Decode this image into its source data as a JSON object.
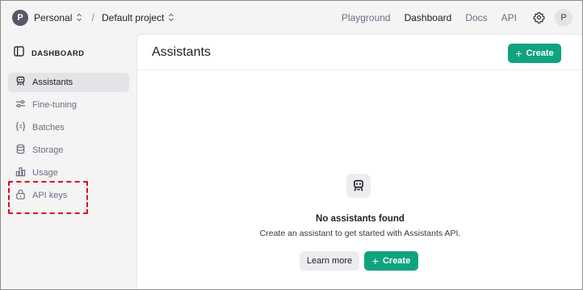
{
  "topbar": {
    "org_avatar": "P",
    "org_name": "Personal",
    "separator": "/",
    "project_name": "Default project",
    "nav": [
      {
        "label": "Playground",
        "active": false
      },
      {
        "label": "Dashboard",
        "active": true
      },
      {
        "label": "Docs",
        "active": false
      },
      {
        "label": "API",
        "active": false
      }
    ],
    "user_avatar": "P"
  },
  "sidebar": {
    "header": "DASHBOARD",
    "items": [
      {
        "label": "Assistants",
        "icon": "robot-icon",
        "active": true
      },
      {
        "label": "Fine-tuning",
        "icon": "sliders-icon",
        "active": false
      },
      {
        "label": "Batches",
        "icon": "braces-icon",
        "active": false
      },
      {
        "label": "Storage",
        "icon": "database-icon",
        "active": false
      },
      {
        "label": "Usage",
        "icon": "bar-chart-icon",
        "active": false
      },
      {
        "label": "API keys",
        "icon": "lock-icon",
        "active": false
      }
    ]
  },
  "main": {
    "title": "Assistants",
    "create_label": "Create",
    "empty_title": "No assistants found",
    "empty_subtitle": "Create an assistant to get started with Assistants API.",
    "learn_more_label": "Learn more",
    "create_label_bottom": "Create"
  },
  "colors": {
    "accent": "#10a37f",
    "highlight": "#e0001b",
    "sidebar_active": "#e4e4e8"
  }
}
